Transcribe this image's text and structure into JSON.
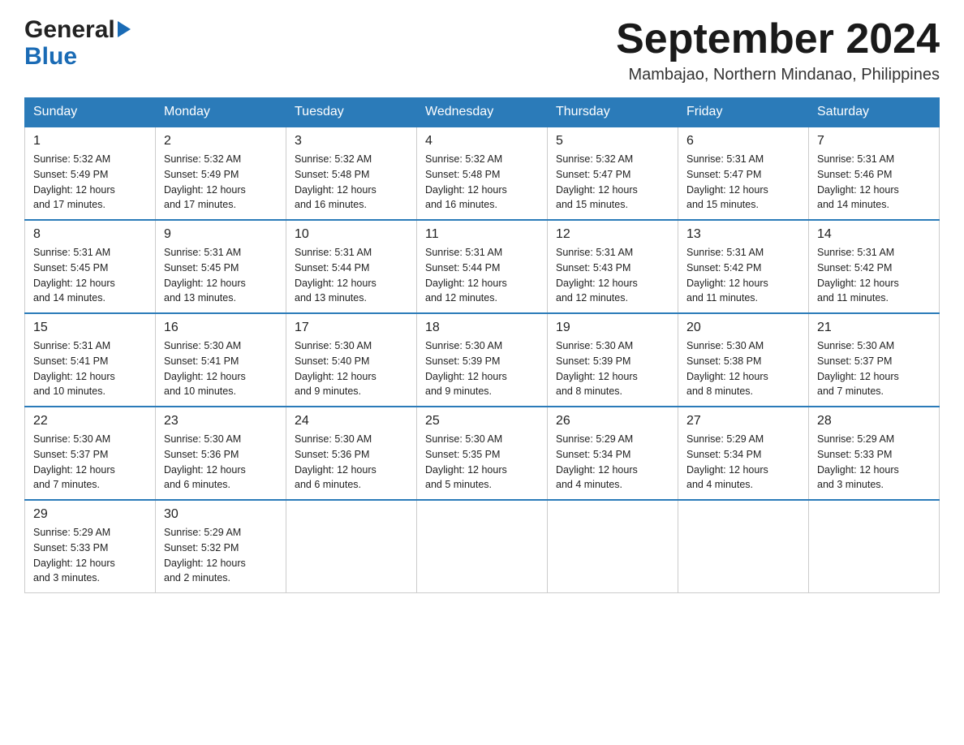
{
  "header": {
    "logo_general": "General",
    "logo_blue": "Blue",
    "month_title": "September 2024",
    "location": "Mambajao, Northern Mindanao, Philippines"
  },
  "days_of_week": [
    "Sunday",
    "Monday",
    "Tuesday",
    "Wednesday",
    "Thursday",
    "Friday",
    "Saturday"
  ],
  "weeks": [
    [
      {
        "day": "1",
        "sunrise": "5:32 AM",
        "sunset": "5:49 PM",
        "daylight": "12 hours and 17 minutes."
      },
      {
        "day": "2",
        "sunrise": "5:32 AM",
        "sunset": "5:49 PM",
        "daylight": "12 hours and 17 minutes."
      },
      {
        "day": "3",
        "sunrise": "5:32 AM",
        "sunset": "5:48 PM",
        "daylight": "12 hours and 16 minutes."
      },
      {
        "day": "4",
        "sunrise": "5:32 AM",
        "sunset": "5:48 PM",
        "daylight": "12 hours and 16 minutes."
      },
      {
        "day": "5",
        "sunrise": "5:32 AM",
        "sunset": "5:47 PM",
        "daylight": "12 hours and 15 minutes."
      },
      {
        "day": "6",
        "sunrise": "5:31 AM",
        "sunset": "5:47 PM",
        "daylight": "12 hours and 15 minutes."
      },
      {
        "day": "7",
        "sunrise": "5:31 AM",
        "sunset": "5:46 PM",
        "daylight": "12 hours and 14 minutes."
      }
    ],
    [
      {
        "day": "8",
        "sunrise": "5:31 AM",
        "sunset": "5:45 PM",
        "daylight": "12 hours and 14 minutes."
      },
      {
        "day": "9",
        "sunrise": "5:31 AM",
        "sunset": "5:45 PM",
        "daylight": "12 hours and 13 minutes."
      },
      {
        "day": "10",
        "sunrise": "5:31 AM",
        "sunset": "5:44 PM",
        "daylight": "12 hours and 13 minutes."
      },
      {
        "day": "11",
        "sunrise": "5:31 AM",
        "sunset": "5:44 PM",
        "daylight": "12 hours and 12 minutes."
      },
      {
        "day": "12",
        "sunrise": "5:31 AM",
        "sunset": "5:43 PM",
        "daylight": "12 hours and 12 minutes."
      },
      {
        "day": "13",
        "sunrise": "5:31 AM",
        "sunset": "5:42 PM",
        "daylight": "12 hours and 11 minutes."
      },
      {
        "day": "14",
        "sunrise": "5:31 AM",
        "sunset": "5:42 PM",
        "daylight": "12 hours and 11 minutes."
      }
    ],
    [
      {
        "day": "15",
        "sunrise": "5:31 AM",
        "sunset": "5:41 PM",
        "daylight": "12 hours and 10 minutes."
      },
      {
        "day": "16",
        "sunrise": "5:30 AM",
        "sunset": "5:41 PM",
        "daylight": "12 hours and 10 minutes."
      },
      {
        "day": "17",
        "sunrise": "5:30 AM",
        "sunset": "5:40 PM",
        "daylight": "12 hours and 9 minutes."
      },
      {
        "day": "18",
        "sunrise": "5:30 AM",
        "sunset": "5:39 PM",
        "daylight": "12 hours and 9 minutes."
      },
      {
        "day": "19",
        "sunrise": "5:30 AM",
        "sunset": "5:39 PM",
        "daylight": "12 hours and 8 minutes."
      },
      {
        "day": "20",
        "sunrise": "5:30 AM",
        "sunset": "5:38 PM",
        "daylight": "12 hours and 8 minutes."
      },
      {
        "day": "21",
        "sunrise": "5:30 AM",
        "sunset": "5:37 PM",
        "daylight": "12 hours and 7 minutes."
      }
    ],
    [
      {
        "day": "22",
        "sunrise": "5:30 AM",
        "sunset": "5:37 PM",
        "daylight": "12 hours and 7 minutes."
      },
      {
        "day": "23",
        "sunrise": "5:30 AM",
        "sunset": "5:36 PM",
        "daylight": "12 hours and 6 minutes."
      },
      {
        "day": "24",
        "sunrise": "5:30 AM",
        "sunset": "5:36 PM",
        "daylight": "12 hours and 6 minutes."
      },
      {
        "day": "25",
        "sunrise": "5:30 AM",
        "sunset": "5:35 PM",
        "daylight": "12 hours and 5 minutes."
      },
      {
        "day": "26",
        "sunrise": "5:29 AM",
        "sunset": "5:34 PM",
        "daylight": "12 hours and 4 minutes."
      },
      {
        "day": "27",
        "sunrise": "5:29 AM",
        "sunset": "5:34 PM",
        "daylight": "12 hours and 4 minutes."
      },
      {
        "day": "28",
        "sunrise": "5:29 AM",
        "sunset": "5:33 PM",
        "daylight": "12 hours and 3 minutes."
      }
    ],
    [
      {
        "day": "29",
        "sunrise": "5:29 AM",
        "sunset": "5:33 PM",
        "daylight": "12 hours and 3 minutes."
      },
      {
        "day": "30",
        "sunrise": "5:29 AM",
        "sunset": "5:32 PM",
        "daylight": "12 hours and 2 minutes."
      },
      null,
      null,
      null,
      null,
      null
    ]
  ],
  "labels": {
    "sunrise": "Sunrise:",
    "sunset": "Sunset:",
    "daylight": "Daylight:"
  }
}
